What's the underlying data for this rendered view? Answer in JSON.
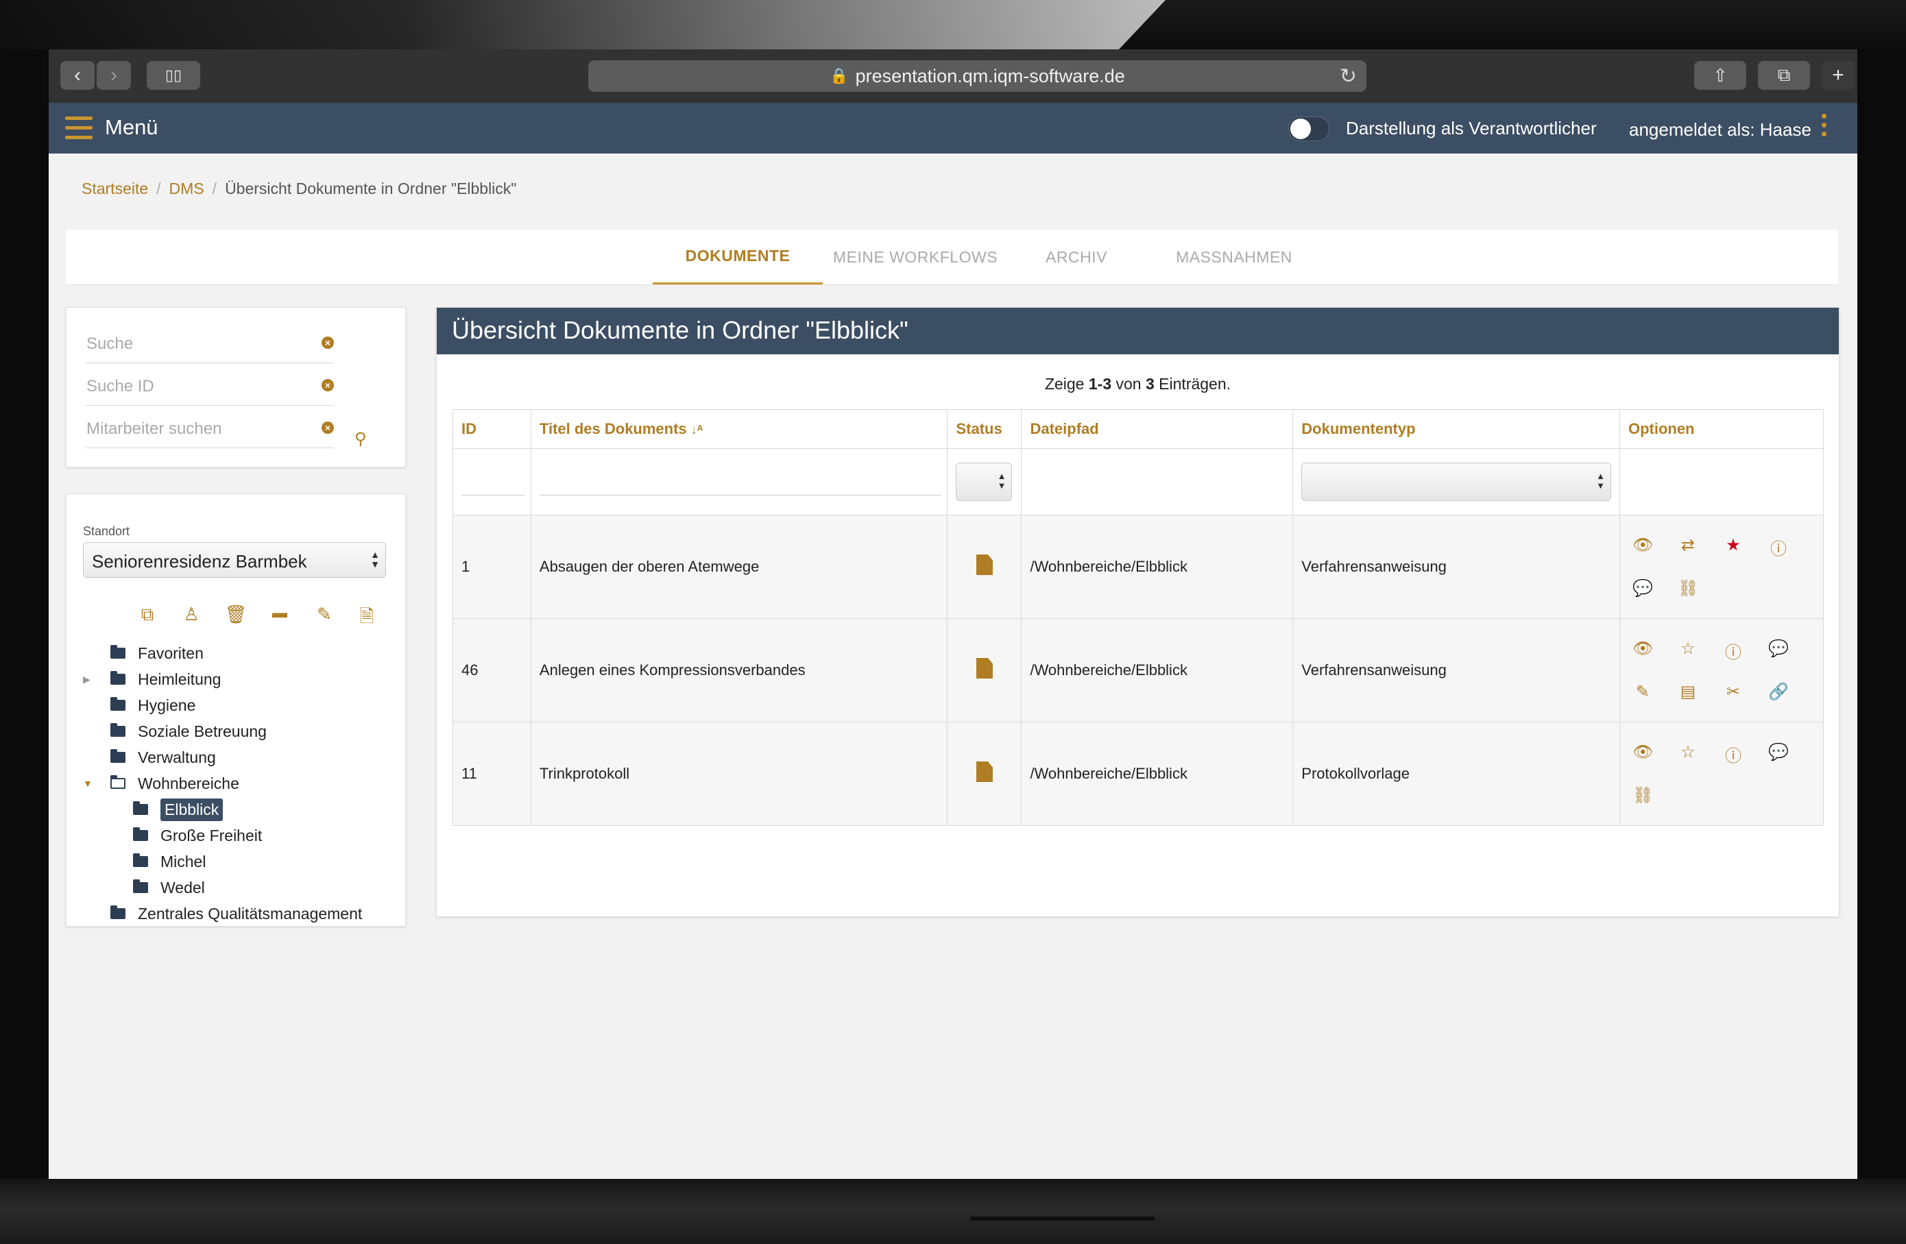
{
  "browser": {
    "url": "presentation.qm.iqm-software.de"
  },
  "header": {
    "menu_label": "Menü",
    "toggle_label": "Darstellung als Verantwortlicher",
    "user_label": "angemeldet als: Haase"
  },
  "breadcrumb": {
    "items": [
      "Startseite",
      "DMS",
      "Übersicht Dokumente in Ordner \"Elbblick\""
    ]
  },
  "tabs": [
    {
      "label": "DOKUMENTE",
      "active": true
    },
    {
      "label": "MEINE WORKFLOWS",
      "active": false
    },
    {
      "label": "ARCHIV",
      "active": false
    },
    {
      "label": "MASSNAHMEN",
      "active": false
    }
  ],
  "search": {
    "fields": [
      {
        "placeholder": "Suche"
      },
      {
        "placeholder": "Suche ID"
      },
      {
        "placeholder": "Mitarbeiter suchen"
      }
    ]
  },
  "tree_panel": {
    "standort_label": "Standort",
    "standort_value": "Seniorenresidenz Barmbek",
    "nodes": [
      {
        "label": "Favoriten",
        "level": 0
      },
      {
        "label": "Heimleitung",
        "level": 0,
        "collapsed": true
      },
      {
        "label": "Hygiene",
        "level": 0
      },
      {
        "label": "Soziale Betreuung",
        "level": 0
      },
      {
        "label": "Verwaltung",
        "level": 0
      },
      {
        "label": "Wohnbereiche",
        "level": 0,
        "expanded": true
      },
      {
        "label": "Elbblick",
        "level": 1,
        "selected": true
      },
      {
        "label": "Große Freiheit",
        "level": 1
      },
      {
        "label": "Michel",
        "level": 1
      },
      {
        "label": "Wedel",
        "level": 1
      },
      {
        "label": "Zentrales Qualitätsmanagement",
        "level": 0
      }
    ]
  },
  "main": {
    "title": "Übersicht Dokumente in Ordner \"Elbblick\"",
    "summary": {
      "prefix": "Zeige ",
      "range": "1-3",
      "middle": " von ",
      "total": "3",
      "suffix": " Einträgen."
    },
    "columns": [
      "ID",
      "Titel des Dokuments",
      "Status",
      "Dateipfad",
      "Dokumententyp",
      "Optionen"
    ],
    "rows": [
      {
        "id": "1",
        "title": "Absaugen der oberen Atemwege",
        "path": "/Wohnbereiche/Elbblick",
        "type": "Verfahrensanweisung",
        "options": [
          "eye-icon",
          "exchange-icon",
          "star-filled-icon",
          "info-icon",
          "comment-icon",
          "unlink-icon"
        ]
      },
      {
        "id": "46",
        "title": "Anlegen eines Kompressionsverbandes",
        "path": "/Wohnbereiche/Elbblick",
        "type": "Verfahrensanweisung",
        "options": [
          "eye-icon",
          "star-outline-icon",
          "info-icon",
          "comment-icon",
          "pencil-icon",
          "archive-icon",
          "scissors-icon",
          "link-icon"
        ]
      },
      {
        "id": "11",
        "title": "Trinkprotokoll",
        "path": "/Wohnbereiche/Elbblick",
        "type": "Protokollvorlage",
        "options": [
          "eye-icon",
          "star-outline-icon",
          "info-icon",
          "comment-icon",
          "unlink-icon"
        ]
      }
    ]
  },
  "colors": {
    "accent": "#b07d23",
    "header_bg": "#3c4e63",
    "favorite_red": "#d0021b"
  }
}
